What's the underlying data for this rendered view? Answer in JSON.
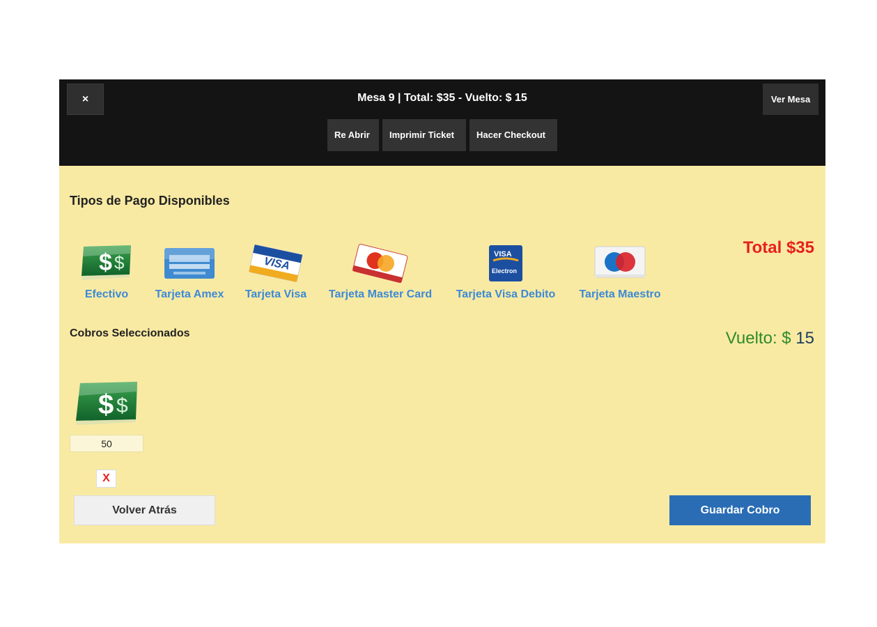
{
  "header": {
    "close_label": "×",
    "title": "Mesa 9 | Total: $35 - Vuelto: $ 15",
    "ver_mesa_label": "Ver Mesa",
    "actions": {
      "reabrir": "Re Abrir",
      "imprimir": "Imprimir Ticket",
      "checkout": "Hacer Checkout"
    }
  },
  "payment_types": {
    "title": "Tipos de Pago Disponibles",
    "items": [
      {
        "label": "Efectivo",
        "icon": "cash-icon"
      },
      {
        "label": "Tarjeta Amex",
        "icon": "amex-card-icon"
      },
      {
        "label": "Tarjeta Visa",
        "icon": "visa-card-icon"
      },
      {
        "label": "Tarjeta Master Card",
        "icon": "mastercard-icon"
      },
      {
        "label": "Tarjeta Visa Debito",
        "icon": "visa-electron-icon"
      },
      {
        "label": "Tarjeta Maestro",
        "icon": "maestro-card-icon"
      }
    ]
  },
  "total_label": "Total $35",
  "cobros": {
    "title": "Cobros Seleccionados",
    "selected_icon": "cash-icon",
    "amount": "50",
    "remove_label": "X"
  },
  "vuelto": {
    "label": "Vuelto: $",
    "value": "15"
  },
  "buttons": {
    "back": "Volver Atrás",
    "save": "Guardar Cobro"
  },
  "colors": {
    "background": "#f9eaa3",
    "header": "#141414",
    "total": "#e8201f",
    "vuelto": "#2f8a2d",
    "link": "#3c8ad6",
    "save": "#2a6db5"
  }
}
